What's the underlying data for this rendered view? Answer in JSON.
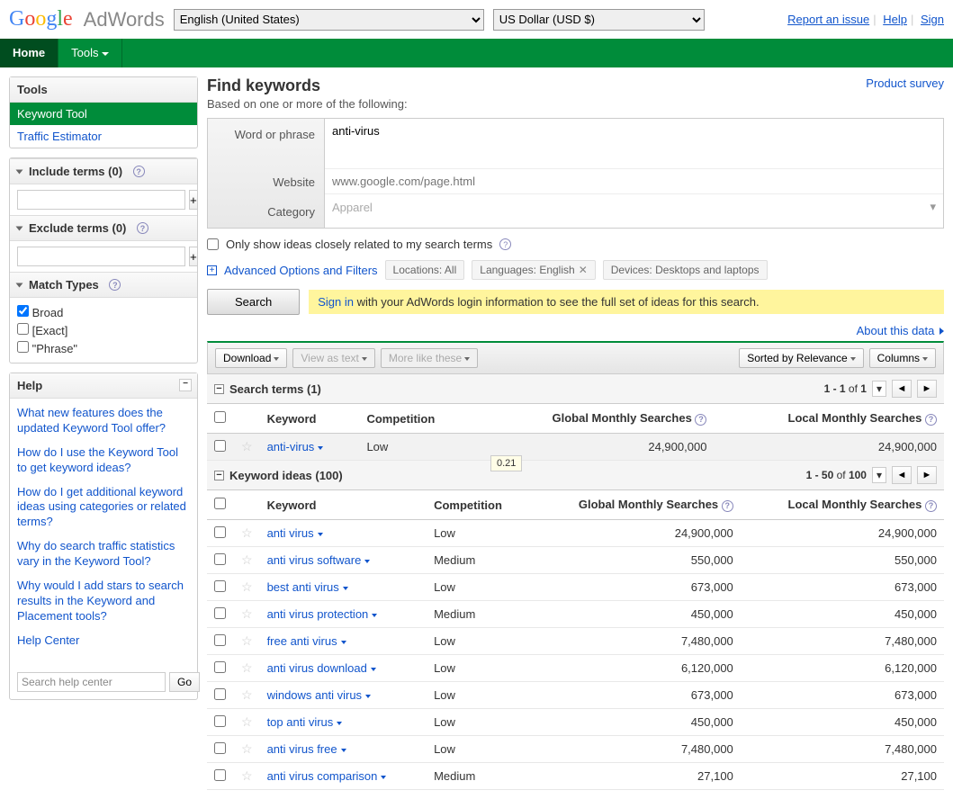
{
  "header": {
    "logo_adwords": "AdWords",
    "lang_options": [
      "English (United States)"
    ],
    "currency_options": [
      "US Dollar (USD $)"
    ],
    "links": {
      "report": "Report an issue",
      "help": "Help",
      "sign": "Sign"
    }
  },
  "nav": {
    "home": "Home",
    "tools": "Tools"
  },
  "sidebar": {
    "tools_title": "Tools",
    "keyword_tool": "Keyword Tool",
    "traffic_estimator": "Traffic Estimator",
    "include_label": "Include terms (0)",
    "exclude_label": "Exclude terms (0)",
    "match_label": "Match Types",
    "match": {
      "broad": "Broad",
      "exact": "[Exact]",
      "phrase": "\"Phrase\""
    },
    "help_title": "Help",
    "help_links": [
      "What new features does the updated Keyword Tool offer?",
      "How do I use the Keyword Tool to get keyword ideas?",
      "How do I get additional keyword ideas using categories or related terms?",
      "Why do search traffic statistics vary in the Keyword Tool?",
      "Why would I add stars to search results in the Keyword and Placement tools?",
      "Help Center"
    ],
    "help_search_placeholder": "Search help center",
    "go": "Go"
  },
  "main": {
    "title": "Find keywords",
    "survey": "Product survey",
    "subtitle": "Based on one or more of the following:",
    "labels": {
      "word": "Word or phrase",
      "website": "Website",
      "category": "Category"
    },
    "word_value": "anti-virus",
    "website_placeholder": "www.google.com/page.html",
    "category_placeholder": "Apparel",
    "only_show": "Only show ideas closely related to my search terms",
    "adv": "Advanced Options and Filters",
    "chips": {
      "loc": "Locations: All",
      "lang": "Languages: English",
      "dev": "Devices: Desktops and laptops"
    },
    "search_btn": "Search",
    "signin": {
      "link": "Sign in",
      "rest": " with your AdWords login information to see the full set of ideas for this search."
    },
    "about": "About this data"
  },
  "toolbar": {
    "download": "Download",
    "view_as_text": "View as text",
    "more_like": "More like these",
    "sorted": "Sorted by Relevance",
    "columns": "Columns"
  },
  "sections": {
    "search_terms": "Search terms (1)",
    "keyword_ideas": "Keyword ideas (100)",
    "pager1": "1 - 1 of 1",
    "pager2": "1 - 50 of 100"
  },
  "cols": {
    "keyword": "Keyword",
    "competition": "Competition",
    "global": "Global Monthly Searches",
    "local": "Local Monthly Searches"
  },
  "tooltip": "0.21",
  "search_terms_rows": [
    {
      "kw": "anti-virus",
      "comp": "Low",
      "global": "24,900,000",
      "local": "24,900,000"
    }
  ],
  "idea_rows": [
    {
      "kw": "anti virus",
      "comp": "Low",
      "global": "24,900,000",
      "local": "24,900,000"
    },
    {
      "kw": "anti virus software",
      "comp": "Medium",
      "global": "550,000",
      "local": "550,000"
    },
    {
      "kw": "best anti virus",
      "comp": "Low",
      "global": "673,000",
      "local": "673,000"
    },
    {
      "kw": "anti virus protection",
      "comp": "Medium",
      "global": "450,000",
      "local": "450,000"
    },
    {
      "kw": "free anti virus",
      "comp": "Low",
      "global": "7,480,000",
      "local": "7,480,000"
    },
    {
      "kw": "anti virus download",
      "comp": "Low",
      "global": "6,120,000",
      "local": "6,120,000"
    },
    {
      "kw": "windows anti virus",
      "comp": "Low",
      "global": "673,000",
      "local": "673,000"
    },
    {
      "kw": "top anti virus",
      "comp": "Low",
      "global": "450,000",
      "local": "450,000"
    },
    {
      "kw": "anti virus free",
      "comp": "Low",
      "global": "7,480,000",
      "local": "7,480,000"
    },
    {
      "kw": "anti virus comparison",
      "comp": "Medium",
      "global": "27,100",
      "local": "27,100"
    }
  ]
}
